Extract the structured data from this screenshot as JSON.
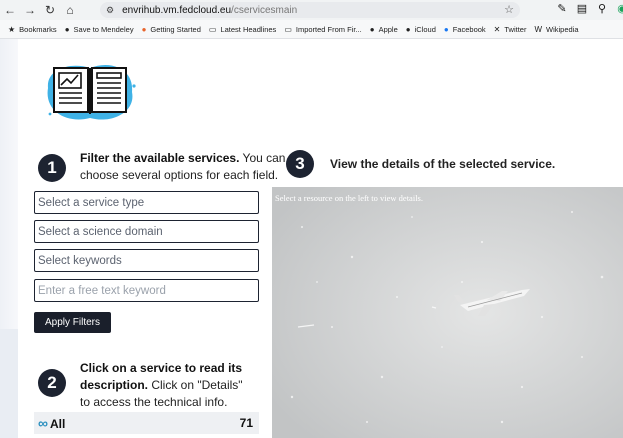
{
  "browser": {
    "url_host": "envrihub.vm.fedcloud.eu",
    "url_path": "/cservicesmain",
    "bookmarks": [
      {
        "label": "Bookmarks",
        "icon": "star-icon"
      },
      {
        "label": "Save to Mendeley",
        "icon": "mendeley-icon"
      },
      {
        "label": "Getting Started",
        "icon": "firefox-icon"
      },
      {
        "label": "Latest Headlines",
        "icon": "folder-icon"
      },
      {
        "label": "Imported From Fir...",
        "icon": "folder-icon"
      },
      {
        "label": "Apple",
        "icon": "apple-icon"
      },
      {
        "label": "iCloud",
        "icon": "apple-icon"
      },
      {
        "label": "Facebook",
        "icon": "facebook-icon"
      },
      {
        "label": "Twitter",
        "icon": "x-icon"
      },
      {
        "label": "Wikipedia",
        "icon": "wikipedia-icon"
      }
    ]
  },
  "steps": {
    "one": {
      "number": "1",
      "bold": "Filter the available services.",
      "rest": " You can choose several options for each field."
    },
    "two": {
      "number": "2",
      "bold": "Click on a service to read its description.",
      "rest": " Click on \"Details\" to access the technical info."
    },
    "three": {
      "number": "3",
      "bold": "View the details of the selected service."
    }
  },
  "filters": {
    "service_type": "Select a service type",
    "science_domain": "Select a science domain",
    "keywords": "Select keywords",
    "free_text_placeholder": "Enter a free text keyword",
    "apply_label": "Apply Filters"
  },
  "results": {
    "all_label": "All",
    "all_count": "71"
  },
  "details": {
    "placeholder": "Select a resource on the left to view details."
  },
  "colors": {
    "accent_dark": "#1d2331",
    "icon_blue": "#3fb2e6"
  }
}
